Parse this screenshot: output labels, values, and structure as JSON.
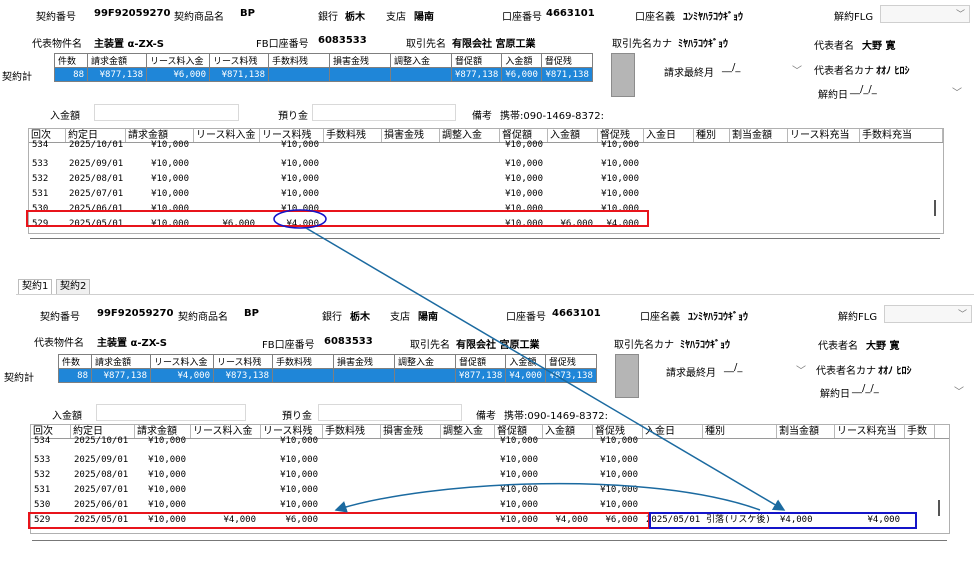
{
  "labels": {
    "contract_no": "契約番号",
    "contract_product": "契約商品名",
    "bank": "銀行",
    "branch": "支店",
    "account_no": "口座番号",
    "account_name": "口座名義",
    "cancel_flg": "解約FLG",
    "rep_property": "代表物件名",
    "fb_account": "FB口座番号",
    "partner_name": "取引先名",
    "partner_kana": "取引先名カナ",
    "rep_name": "代表者名",
    "billing_last_month": "請求最終月",
    "rep_kana": "代表者名カナ",
    "cancel_date": "解約日",
    "contract_total": "契約計",
    "deposit_amount": "入金額",
    "deposit_held": "預り金",
    "remarks": "備考"
  },
  "sum_headers": [
    "件数",
    "請求金額",
    "リース料入金",
    "リース料残",
    "手数料残",
    "損害金残",
    "調整入金",
    "督促額",
    "入金額",
    "督促残"
  ],
  "grid_headers": [
    "回次",
    "約定日",
    "請求金額",
    "リース料入金",
    "リース料残",
    "手数料残",
    "損害金残",
    "調整入金",
    "督促額",
    "入金額",
    "督促残",
    "入金日",
    "種別",
    "割当金額",
    "リース料充当",
    "手数料充当"
  ],
  "grid_headers_bottom_last": "手数",
  "blank_date": "__/_",
  "blank_date_full": "__/_/_",
  "tabs": [
    "契約1",
    "契約2"
  ],
  "top": {
    "contract_no": "99F92059270",
    "contract_product": "BP",
    "bank": "栃木",
    "branch": "陽南",
    "account_no": "4663101",
    "account_name": "ﾕﾝﾐﾔﾊﾗｺｳｷﾞｮｳ",
    "rep_property": "主装置 α-ZX-S",
    "fb_account": "6083533",
    "partner_name": "有限会社 宮原工業",
    "partner_kana": "ﾐﾔﾊﾗｺｳｷﾞｮｳ",
    "rep_name": "大野 寛",
    "rep_kana": "ｵｵﾉ ﾋﾛｼ",
    "remarks": "携帯:090-1469-8372:",
    "sum": [
      "88",
      "¥877,138",
      "¥6,000",
      "¥871,138",
      "",
      "",
      "",
      "¥877,138",
      "¥6,000",
      "¥871,138"
    ],
    "rows": [
      [
        "534",
        "2025/10/01",
        "¥10,000",
        "",
        "¥10,000",
        "",
        "",
        "",
        "¥10,000",
        "",
        "¥10,000",
        "",
        "",
        "",
        "",
        ""
      ],
      [
        "533",
        "2025/09/01",
        "¥10,000",
        "",
        "¥10,000",
        "",
        "",
        "",
        "¥10,000",
        "",
        "¥10,000",
        "",
        "",
        "",
        "",
        ""
      ],
      [
        "532",
        "2025/08/01",
        "¥10,000",
        "",
        "¥10,000",
        "",
        "",
        "",
        "¥10,000",
        "",
        "¥10,000",
        "",
        "",
        "",
        "",
        ""
      ],
      [
        "531",
        "2025/07/01",
        "¥10,000",
        "",
        "¥10,000",
        "",
        "",
        "",
        "¥10,000",
        "",
        "¥10,000",
        "",
        "",
        "",
        "",
        ""
      ],
      [
        "530",
        "2025/06/01",
        "¥10,000",
        "",
        "¥10,000",
        "",
        "",
        "",
        "¥10,000",
        "",
        "¥10,000",
        "",
        "",
        "",
        "",
        ""
      ],
      [
        "529",
        "2025/05/01",
        "¥10,000",
        "¥6,000",
        "¥4,000",
        "",
        "",
        "",
        "¥10,000",
        "¥6,000",
        "¥4,000",
        "",
        "",
        "",
        "",
        ""
      ]
    ]
  },
  "bottom": {
    "contract_no": "99F92059270",
    "contract_product": "BP",
    "bank": "栃木",
    "branch": "陽南",
    "account_no": "4663101",
    "account_name": "ﾕﾝﾐﾔﾊﾗｺｳｷﾞｮｳ",
    "rep_property": "主装置 α-ZX-S",
    "fb_account": "6083533",
    "partner_name": "有限会社 宮原工業",
    "partner_kana": "ﾐﾔﾊﾗｺｳｷﾞｮｳ",
    "rep_name": "大野 寛",
    "rep_kana": "ｵｵﾉ ﾋﾛｼ",
    "remarks": "携帯:090-1469-8372:",
    "sum": [
      "88",
      "¥877,138",
      "¥4,000",
      "¥873,138",
      "",
      "",
      "",
      "¥877,138",
      "¥4,000",
      "¥873,138"
    ],
    "rows": [
      [
        "534",
        "2025/10/01",
        "¥10,000",
        "",
        "¥10,000",
        "",
        "",
        "",
        "¥10,000",
        "",
        "¥10,000",
        "",
        "",
        "",
        "",
        ""
      ],
      [
        "533",
        "2025/09/01",
        "¥10,000",
        "",
        "¥10,000",
        "",
        "",
        "",
        "¥10,000",
        "",
        "¥10,000",
        "",
        "",
        "",
        "",
        ""
      ],
      [
        "532",
        "2025/08/01",
        "¥10,000",
        "",
        "¥10,000",
        "",
        "",
        "",
        "¥10,000",
        "",
        "¥10,000",
        "",
        "",
        "",
        "",
        ""
      ],
      [
        "531",
        "2025/07/01",
        "¥10,000",
        "",
        "¥10,000",
        "",
        "",
        "",
        "¥10,000",
        "",
        "¥10,000",
        "",
        "",
        "",
        "",
        ""
      ],
      [
        "530",
        "2025/06/01",
        "¥10,000",
        "",
        "¥10,000",
        "",
        "",
        "",
        "¥10,000",
        "",
        "¥10,000",
        "",
        "",
        "",
        "",
        ""
      ],
      [
        "529",
        "2025/05/01",
        "¥10,000",
        "¥4,000",
        "¥6,000",
        "",
        "",
        "",
        "¥10,000",
        "¥4,000",
        "¥6,000",
        "2025/05/01",
        "引落(リスケ後)",
        "¥4,000",
        "¥4,000",
        ""
      ]
    ]
  },
  "colors": {
    "highlight_red": "#e8141b",
    "highlight_blue": "#1414c8",
    "arrow": "#1b6aa0",
    "selected_row_bg": "#1f86d8"
  }
}
